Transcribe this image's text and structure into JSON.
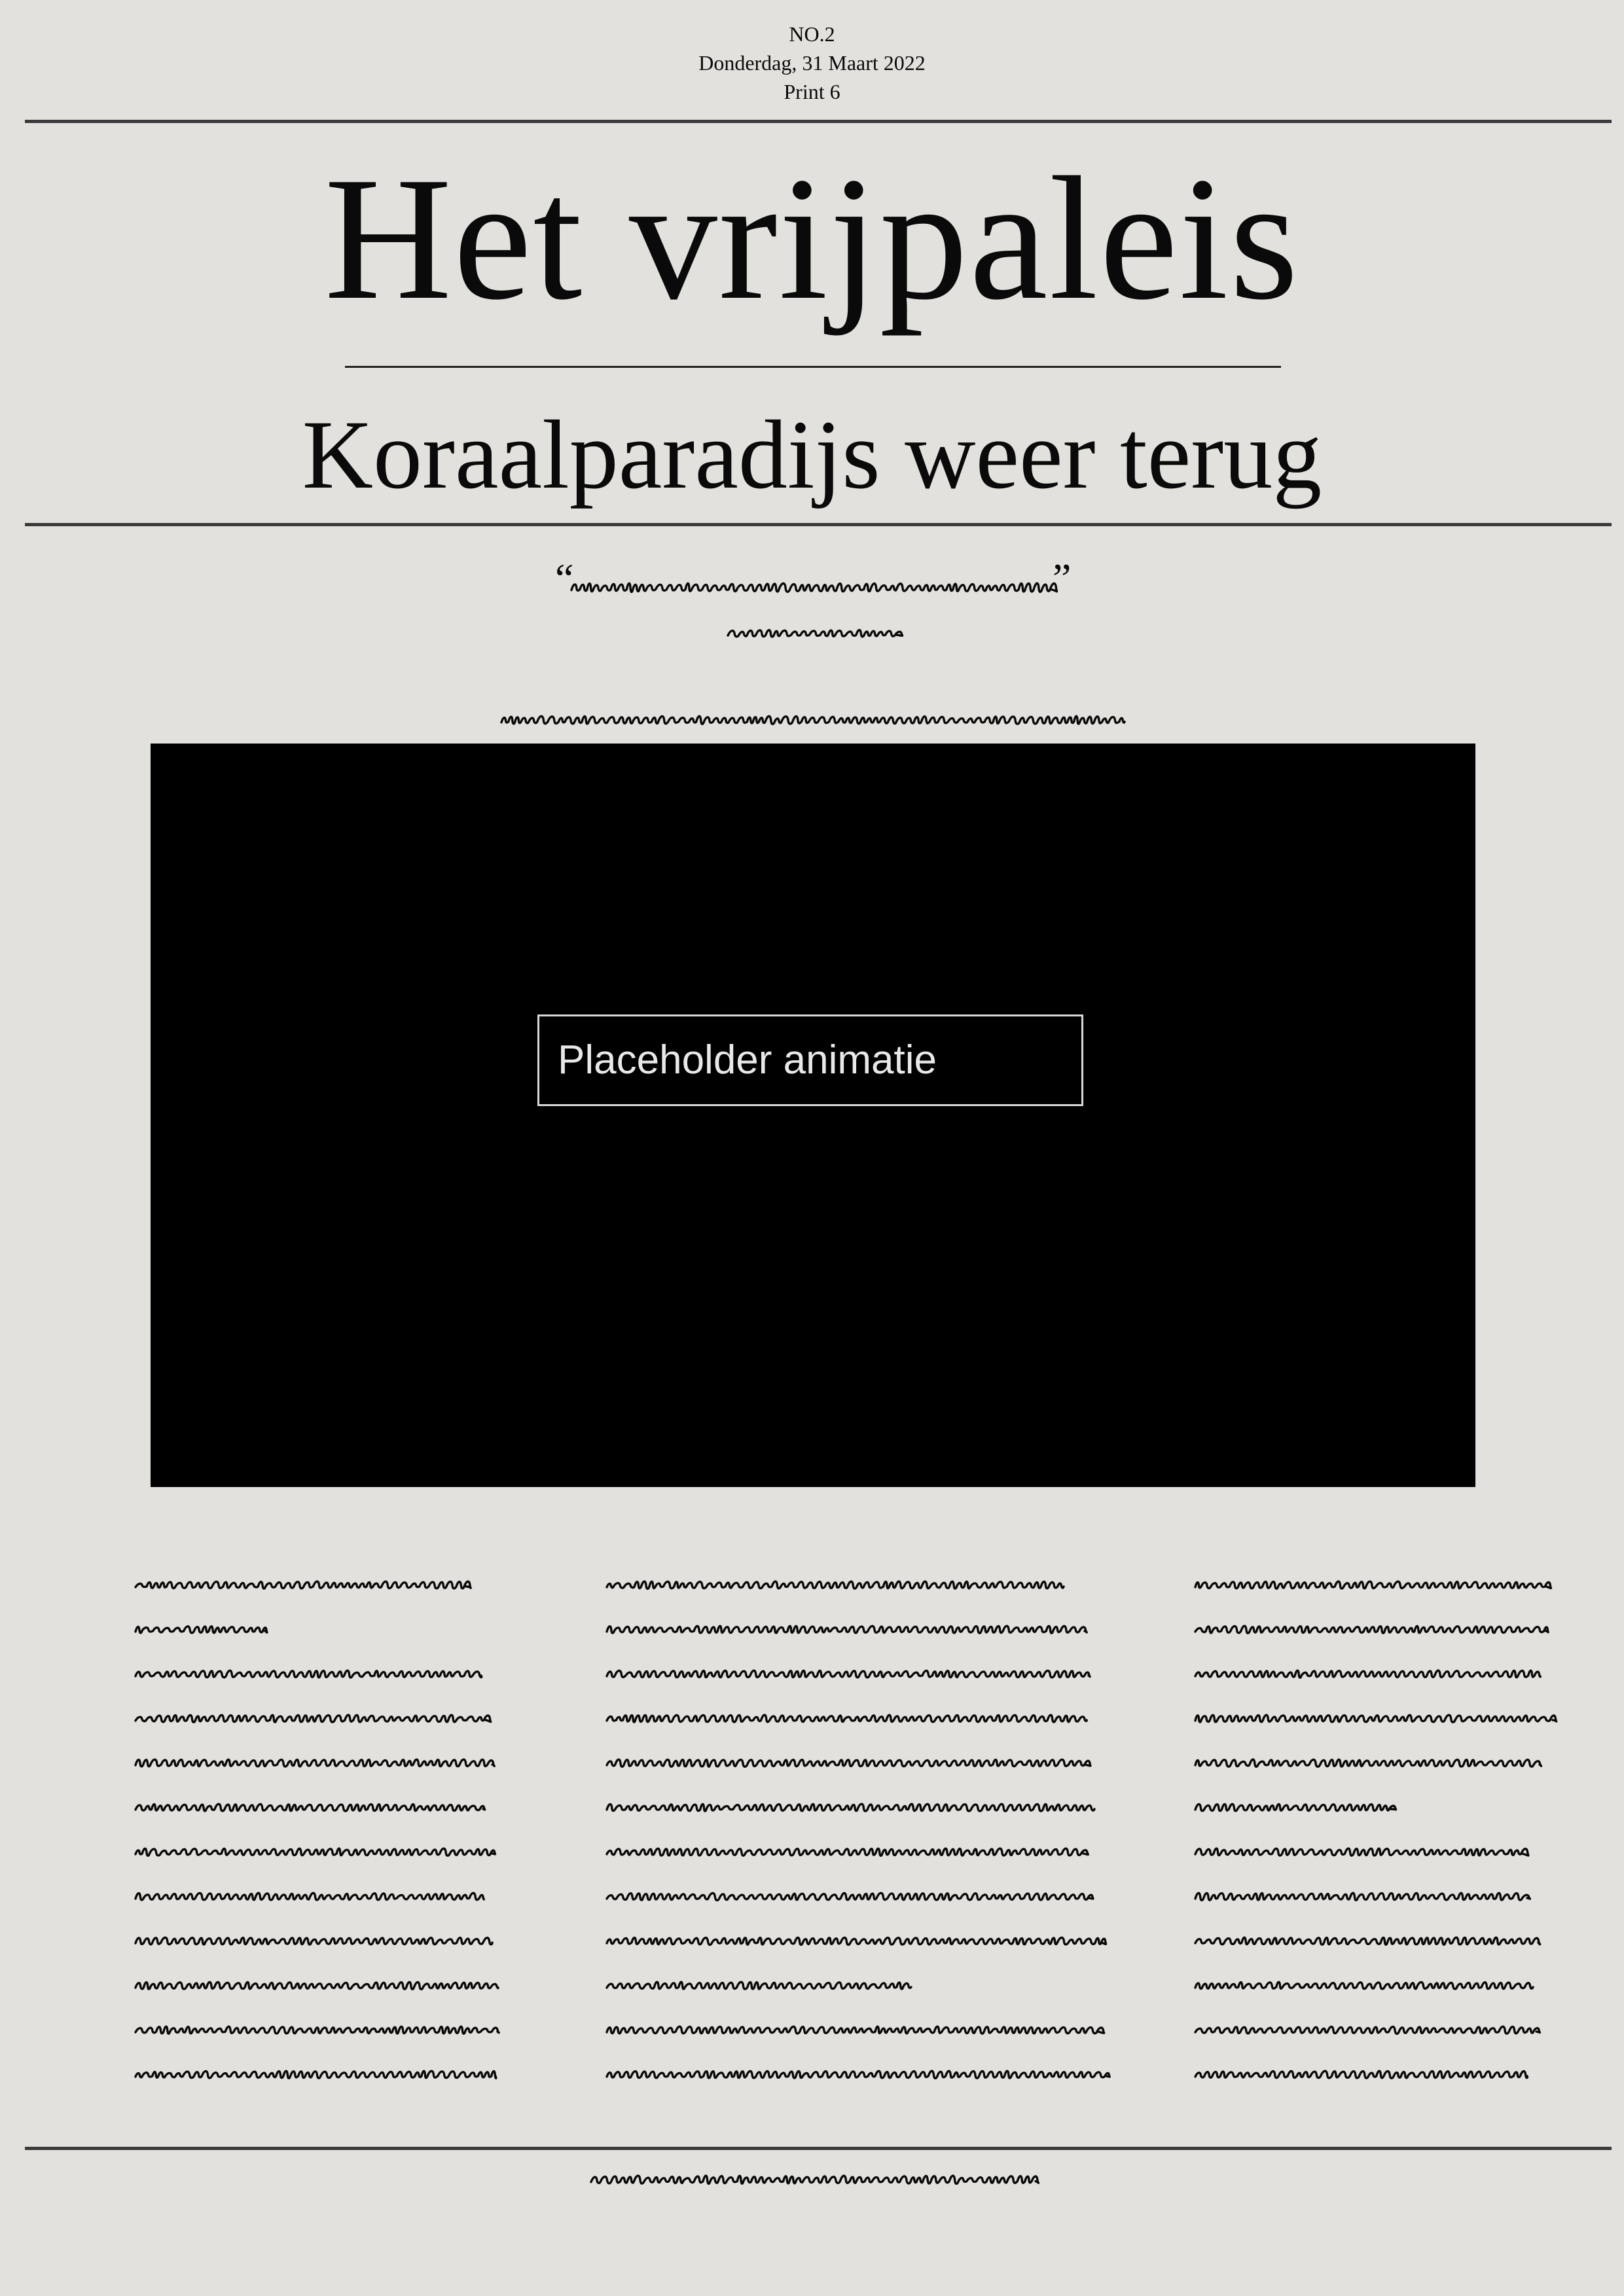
{
  "header": {
    "issue": "NO.2",
    "date": "Donderdag, 31 Maart 2022",
    "print": "Print 6"
  },
  "masthead": {
    "title": "Het vrijpaleis"
  },
  "headline": {
    "text": "Koraalparadijs weer terug"
  },
  "quote": {
    "open_mark": "“",
    "close_mark": "”"
  },
  "video": {
    "placeholder_label": "Placeholder animatie",
    "background": "#000000"
  },
  "colors": {
    "page_background": "#e3e1dd",
    "ink": "#0a0a0a",
    "rule": "#3a3a3a"
  }
}
